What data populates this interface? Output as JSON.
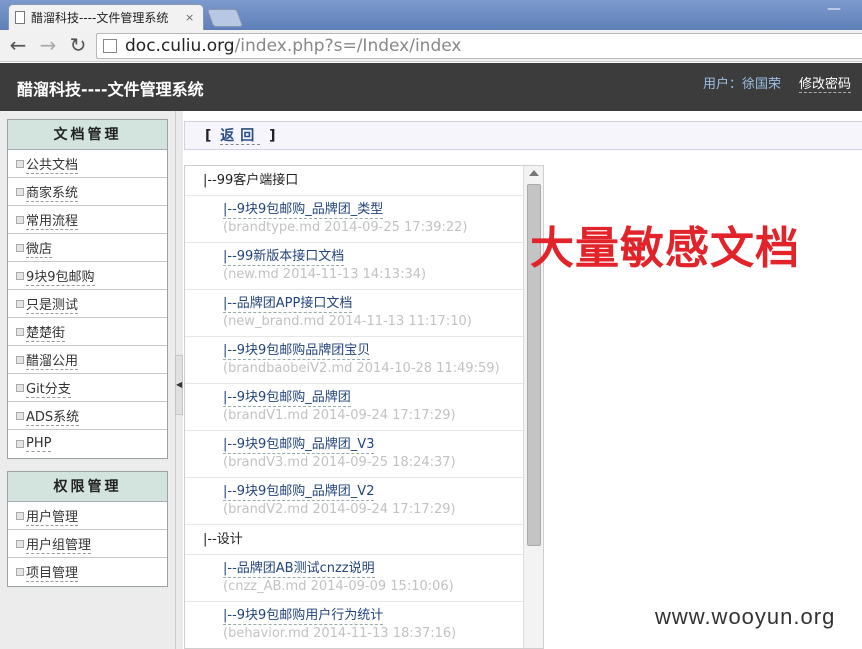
{
  "browser": {
    "tab_title": "醋溜科技----文件管理系统",
    "tab_close": "×",
    "url_host": "doc.culiu.org",
    "url_path": "/index.php?s=/Index/index"
  },
  "header": {
    "title": "醋溜科技----文件管理系统",
    "user_label": "用户：徐国荣",
    "change_password": "修改密码"
  },
  "sidebar": {
    "doc_panel": {
      "title": "文档管理",
      "items": [
        "公共文档",
        "商家系统",
        "常用流程",
        "微店",
        "9块9包邮购",
        "只是测试",
        "楚楚街",
        "醋溜公用",
        "Git分支",
        "ADS系统",
        "PHP"
      ]
    },
    "perm_panel": {
      "title": "权限管理",
      "items": [
        "用户管理",
        "用户组管理",
        "项目管理"
      ]
    }
  },
  "main": {
    "back_open": "[",
    "back_label": "返回",
    "back_close": "]",
    "groups": [
      {
        "label": "|--99客户端接口",
        "docs": [
          {
            "title": "|--9块9包邮购_品牌团_类型",
            "meta": "(brandtype.md  2014-09-25 17:39:22)"
          },
          {
            "title": "|--99新版本接口文档",
            "meta": "(new.md  2014-11-13 14:13:34)"
          },
          {
            "title": "|--品牌团APP接口文档",
            "meta": "(new_brand.md  2014-11-13 11:17:10)"
          },
          {
            "title": "|--9块9包邮购品牌团宝贝",
            "meta": "(brandbaobeiV2.md  2014-10-28 11:49:59)"
          },
          {
            "title": "|--9块9包邮购_品牌团",
            "meta": "(brandV1.md  2014-09-24 17:17:29)"
          },
          {
            "title": "|--9块9包邮购_品牌团_V3",
            "meta": "(brandV3.md  2014-09-25 18:24:37)"
          },
          {
            "title": "|--9块9包邮购_品牌团_V2",
            "meta": "(brandV2.md  2014-09-24 17:17:29)"
          }
        ]
      },
      {
        "label": "|--设计",
        "docs": [
          {
            "title": "|--品牌团AB测试cnzz说明",
            "meta": "(cnzz_AB.md  2014-09-09 15:10:06)"
          },
          {
            "title": "|--9块9包邮购用户行为统计",
            "meta": "(behavior.md  2014-11-13 18:37:16)"
          }
        ]
      }
    ]
  },
  "annotation": "大量敏感文档",
  "watermark": "www.wooyun.org"
}
